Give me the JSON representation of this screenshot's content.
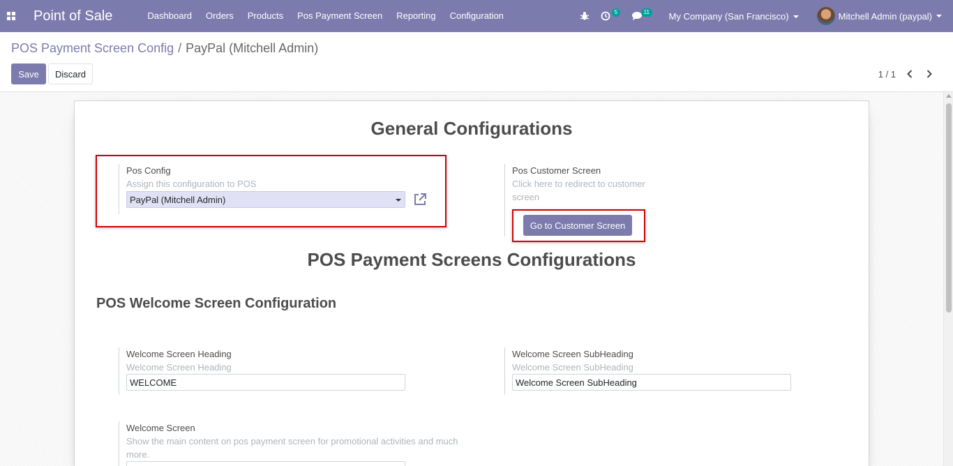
{
  "navbar": {
    "app_name": "Point of Sale",
    "menu": [
      "Dashboard",
      "Orders",
      "Products",
      "Pos Payment Screen",
      "Reporting",
      "Configuration"
    ],
    "activity_count": "5",
    "message_count": "11",
    "company": "My Company (San Francisco)",
    "user": "Mitchell Admin (paypal)",
    "bg_color": "#7c7bad",
    "badge_color": "#00a09d"
  },
  "breadcrumb": {
    "parent": "POS Payment Screen Config",
    "separator": "/",
    "current": "PayPal (Mitchell Admin)"
  },
  "toolbar": {
    "save_label": "Save",
    "discard_label": "Discard",
    "pager": "1 / 1"
  },
  "form": {
    "general_title": "General Configurations",
    "pos_config": {
      "label": "Pos Config",
      "help": "Assign this configuration to POS",
      "value": "PayPal (Mitchell Admin)"
    },
    "customer_screen": {
      "label": "Pos Customer Screen",
      "help_line1": "Click here to redirect to customer",
      "help_line2": "screen",
      "button": "Go to Customer Screen"
    },
    "payment_screens_title": "POS Payment Screens Configurations",
    "welcome_section_title": "POS Welcome Screen Configuration",
    "welcome_heading": {
      "label": "Welcome Screen Heading",
      "placeholder": "Welcome Screen Heading",
      "value": "WELCOME"
    },
    "welcome_subheading": {
      "label": "Welcome Screen SubHeading",
      "placeholder": "Welcome Screen SubHeading",
      "value": "Welcome Screen SubHeading"
    },
    "welcome_screen": {
      "label": "Welcome Screen",
      "help_line1": "Show the main content on pos payment screen for promotional activities and much",
      "help_line2": "more."
    }
  },
  "highlight_color": "#d00000"
}
